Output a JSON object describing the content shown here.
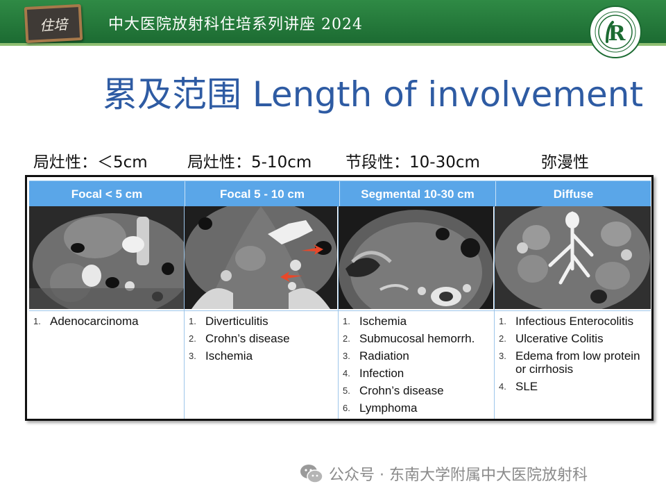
{
  "header": {
    "logo_text": "住培",
    "series_title": "中大医院放射科住培系列讲座 2024",
    "emblem_letters": "R"
  },
  "title": "累及范围 Length of involvement",
  "column_headers": [
    "局灶性：＜5cm",
    "局灶性：5-10cm",
    "节段性：10-30cm",
    "弥漫性"
  ],
  "table": {
    "categories": [
      "Focal  < 5 cm",
      "Focal   5 - 10 cm",
      "Segmental 10-30 cm",
      "Diffuse"
    ],
    "lists": [
      [
        "Adenocarcinoma"
      ],
      [
        "Diverticulitis",
        "Crohn’s disease",
        "Ischemia"
      ],
      [
        "Ischemia",
        "Submucosal hemorrh.",
        "Radiation",
        "Infection",
        "Crohn’s disease",
        "Lymphoma"
      ],
      [
        "Infectious Enterocolitis",
        "Ulcerative Colitis",
        "Edema from low protein or cirrhosis",
        "SLE"
      ]
    ],
    "images": [
      "ct-image-focal-small",
      "ct-image-focal-medium",
      "ct-image-segmental",
      "ct-image-diffuse"
    ]
  },
  "watermark": "公众号 · 东南大学附属中大医院放射科",
  "colors": {
    "banner_green": "#1c6b32",
    "title_blue": "#2e5ba3",
    "table_header_blue": "#5aa6e8",
    "arrow_red": "#e8482a"
  }
}
